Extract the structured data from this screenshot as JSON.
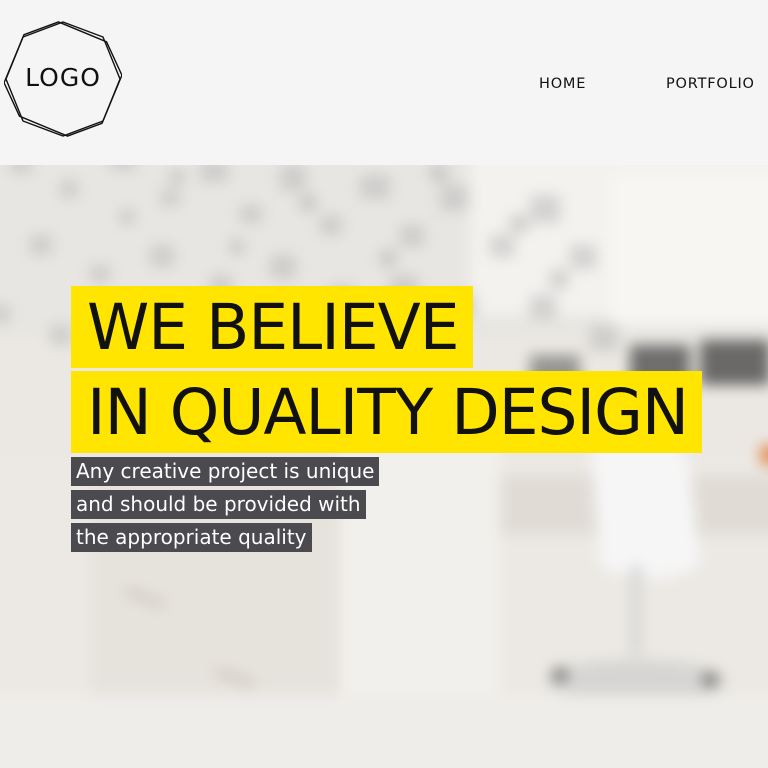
{
  "header": {
    "logo_text": "LOGO",
    "nav": {
      "home": "HOME",
      "portfolio": "PORTFOLIO"
    }
  },
  "hero": {
    "headline": {
      "line1": "WE BELIEVE",
      "line2": "IN QUALITY DESIGN"
    },
    "subtitle": {
      "line1": "Any creative project is unique",
      "line2": "and should be provided with",
      "line3": "the appropriate quality"
    }
  },
  "colors": {
    "header_bg": "#f5f5f5",
    "headline_highlight": "#ffe500",
    "subtitle_bg": "#4a4a4f",
    "subtitle_text": "#ffffff",
    "text_dark": "#111111"
  }
}
